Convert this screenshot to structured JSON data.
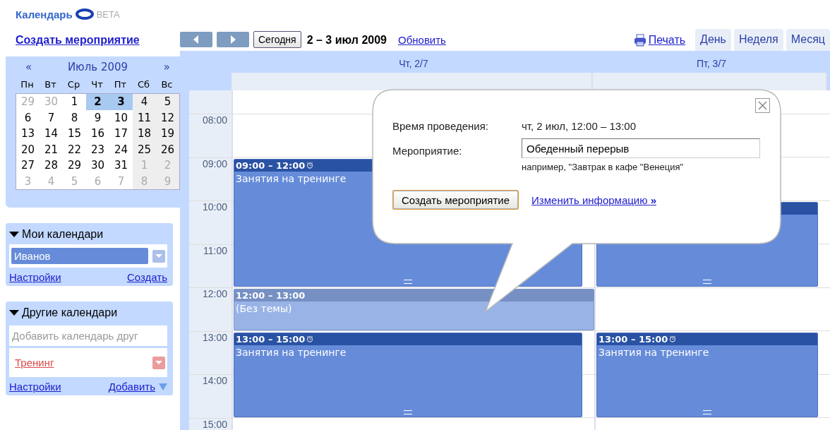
{
  "logo": {
    "text": "Календарь",
    "badge": "BETA"
  },
  "create_link": "Создать мероприятие",
  "toolbar": {
    "today": "Сегодня",
    "range": "2 – 3 июл 2009",
    "refresh": "Обновить",
    "print": "Печать"
  },
  "view_tabs": [
    {
      "label": "День",
      "selected": false
    },
    {
      "label": "Неделя",
      "selected": false
    },
    {
      "label": "Месяц",
      "selected": false
    }
  ],
  "mini_calendar": {
    "prev": "«",
    "title": "Июль 2009",
    "next": "»",
    "weekdays": [
      {
        "label": "Пн",
        "weekend": false
      },
      {
        "label": "Вт",
        "weekend": false
      },
      {
        "label": "Ср",
        "weekend": false
      },
      {
        "label": "Чт",
        "weekend": false
      },
      {
        "label": "Пт",
        "weekend": false
      },
      {
        "label": "Сб",
        "weekend": true
      },
      {
        "label": "Вс",
        "weekend": true
      }
    ],
    "weeks": [
      [
        {
          "day": "29",
          "other_month": true,
          "selected": false
        },
        {
          "day": "30",
          "other_month": true,
          "selected": false
        },
        {
          "day": "1",
          "other_month": false,
          "selected": false
        },
        {
          "day": "2",
          "other_month": false,
          "selected": true
        },
        {
          "day": "3",
          "other_month": false,
          "selected": true
        },
        {
          "day": "4",
          "other_month": false,
          "selected": false
        },
        {
          "day": "5",
          "other_month": false,
          "selected": false
        }
      ],
      [
        {
          "day": "6",
          "other_month": false,
          "selected": false
        },
        {
          "day": "7",
          "other_month": false,
          "selected": false
        },
        {
          "day": "8",
          "other_month": false,
          "selected": false
        },
        {
          "day": "9",
          "other_month": false,
          "selected": false
        },
        {
          "day": "10",
          "other_month": false,
          "selected": false
        },
        {
          "day": "11",
          "other_month": false,
          "selected": false
        },
        {
          "day": "12",
          "other_month": false,
          "selected": false
        }
      ],
      [
        {
          "day": "13",
          "other_month": false,
          "selected": false
        },
        {
          "day": "14",
          "other_month": false,
          "selected": false
        },
        {
          "day": "15",
          "other_month": false,
          "selected": false
        },
        {
          "day": "16",
          "other_month": false,
          "selected": false
        },
        {
          "day": "17",
          "other_month": false,
          "selected": false
        },
        {
          "day": "18",
          "other_month": false,
          "selected": false
        },
        {
          "day": "19",
          "other_month": false,
          "selected": false
        }
      ],
      [
        {
          "day": "20",
          "other_month": false,
          "selected": false
        },
        {
          "day": "21",
          "other_month": false,
          "selected": false
        },
        {
          "day": "22",
          "other_month": false,
          "selected": false
        },
        {
          "day": "23",
          "other_month": false,
          "selected": false
        },
        {
          "day": "24",
          "other_month": false,
          "selected": false
        },
        {
          "day": "25",
          "other_month": false,
          "selected": false
        },
        {
          "day": "26",
          "other_month": false,
          "selected": false
        }
      ],
      [
        {
          "day": "27",
          "other_month": false,
          "selected": false
        },
        {
          "day": "28",
          "other_month": false,
          "selected": false
        },
        {
          "day": "29",
          "other_month": false,
          "selected": false
        },
        {
          "day": "30",
          "other_month": false,
          "selected": false
        },
        {
          "day": "31",
          "other_month": false,
          "selected": false
        },
        {
          "day": "1",
          "other_month": true,
          "selected": false
        },
        {
          "day": "2",
          "other_month": true,
          "selected": false
        }
      ],
      [
        {
          "day": "3",
          "other_month": true,
          "selected": false
        },
        {
          "day": "4",
          "other_month": true,
          "selected": false
        },
        {
          "day": "5",
          "other_month": true,
          "selected": false
        },
        {
          "day": "6",
          "other_month": true,
          "selected": false
        },
        {
          "day": "7",
          "other_month": true,
          "selected": false
        },
        {
          "day": "8",
          "other_month": true,
          "selected": false
        },
        {
          "day": "9",
          "other_month": true,
          "selected": false
        }
      ]
    ]
  },
  "my_calendars": {
    "title": "Мои календари",
    "items": [
      {
        "name": "Иванов",
        "color": "#668cd9"
      }
    ],
    "links": [
      "Настройки",
      "Создать"
    ]
  },
  "other_calendars": {
    "title": "Другие календари",
    "add_placeholder": "Добавить календарь друг",
    "items": [
      {
        "name": "Тренинг",
        "color": "#dd4b4b"
      }
    ],
    "links": [
      "Настройки",
      "Добавить"
    ]
  },
  "days": [
    {
      "label": "Чт, 2/7",
      "slots": [
        {
          "kind": "free"
        },
        {
          "kind": "event_start",
          "draft": false,
          "time": "09:00 – 12:00",
          "title": "Занятия на тренинге",
          "reminder": true
        },
        {
          "kind": "event_more"
        },
        {
          "kind": "event_more"
        },
        {
          "kind": "event_start",
          "draft": true,
          "time": "12:00 – 13:00",
          "title": "(Без темы)"
        },
        {
          "kind": "event_start",
          "draft": false,
          "time": "13:00 – 15:00",
          "title": "Занятия на тренинге",
          "reminder": true
        },
        {
          "kind": "event_more"
        },
        {
          "kind": "free"
        }
      ]
    },
    {
      "label": "Пт, 3/7",
      "slots": [
        {
          "kind": "free"
        },
        {
          "kind": "free"
        },
        {
          "kind": "event_start",
          "draft": false
        },
        {
          "kind": "event_more"
        },
        {
          "kind": "free"
        },
        {
          "kind": "event_start",
          "draft": false,
          "time": "13:00 – 15:00",
          "title": "Занятия на тренинге",
          "reminder": true
        },
        {
          "kind": "event_more"
        },
        {
          "kind": "free"
        }
      ]
    }
  ],
  "hours": [
    "08:00",
    "09:00",
    "10:00",
    "11:00",
    "12:00",
    "13:00",
    "14:00",
    "15:00"
  ],
  "popup": {
    "when_label": "Время проведения:",
    "when_value": "чт, 2 июл, 12:00 – 13:00",
    "what_label": "Мероприятие:",
    "what_value": "Обеденный перерыв",
    "hint": "например, \"Завтрак в кафе \"Венеция\"",
    "create_button": "Создать мероприятие",
    "edit_link": "Изменить информацию **»**"
  }
}
